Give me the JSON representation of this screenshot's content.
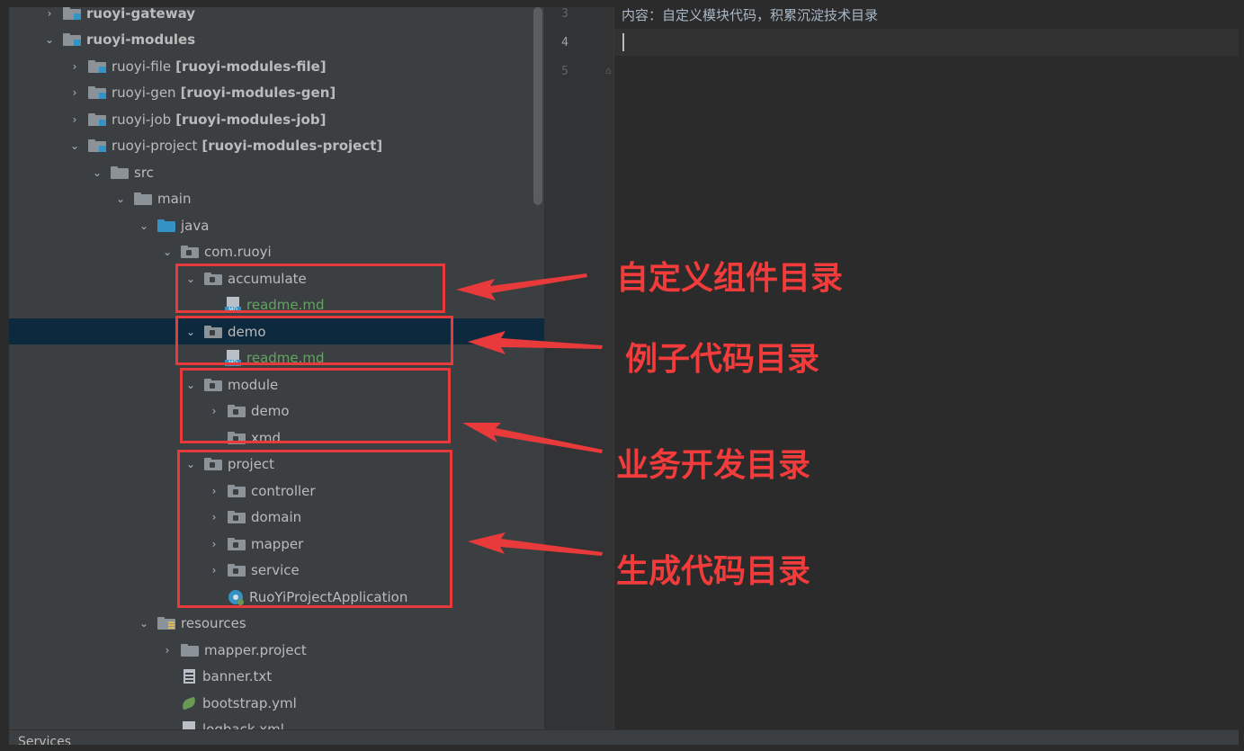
{
  "tree": {
    "items": [
      {
        "label": "ruoyi-gateway",
        "bold": true,
        "icon": "module-folder",
        "chevron": "collapsed"
      },
      {
        "label": "ruoyi-modules",
        "bold": true,
        "icon": "module-folder",
        "chevron": "expanded"
      },
      {
        "label": "ruoyi-file",
        "suffix": "[ruoyi-modules-file]",
        "icon": "module-folder",
        "chevron": "collapsed"
      },
      {
        "label": "ruoyi-gen",
        "suffix": "[ruoyi-modules-gen]",
        "icon": "module-folder",
        "chevron": "collapsed"
      },
      {
        "label": "ruoyi-job",
        "suffix": "[ruoyi-modules-job]",
        "icon": "module-folder",
        "chevron": "collapsed"
      },
      {
        "label": "ruoyi-project",
        "suffix": "[ruoyi-modules-project]",
        "icon": "module-folder",
        "chevron": "expanded"
      },
      {
        "label": "src",
        "icon": "folder",
        "chevron": "expanded"
      },
      {
        "label": "main",
        "icon": "folder",
        "chevron": "expanded"
      },
      {
        "label": "java",
        "icon": "source-folder",
        "chevron": "expanded"
      },
      {
        "label": "com.ruoyi",
        "icon": "package-folder",
        "chevron": "expanded"
      },
      {
        "label": "accumulate",
        "icon": "package-folder",
        "chevron": "expanded"
      },
      {
        "label": "readme.md",
        "icon": "markdown-file",
        "chevron": "none",
        "green": true
      },
      {
        "label": "demo",
        "icon": "package-folder",
        "chevron": "expanded",
        "selected": true
      },
      {
        "label": "readme.md",
        "icon": "markdown-file",
        "chevron": "none",
        "green": true
      },
      {
        "label": "module",
        "icon": "package-folder",
        "chevron": "expanded"
      },
      {
        "label": "demo",
        "icon": "package-folder",
        "chevron": "collapsed"
      },
      {
        "label": "xmd",
        "icon": "package-folder",
        "chevron": "none"
      },
      {
        "label": "project",
        "icon": "package-folder",
        "chevron": "expanded"
      },
      {
        "label": "controller",
        "icon": "package-folder",
        "chevron": "collapsed"
      },
      {
        "label": "domain",
        "icon": "package-folder",
        "chevron": "collapsed"
      },
      {
        "label": "mapper",
        "icon": "package-folder",
        "chevron": "collapsed"
      },
      {
        "label": "service",
        "icon": "package-folder",
        "chevron": "collapsed"
      },
      {
        "label": "RuoYiProjectApplication",
        "icon": "spring-app-class",
        "chevron": "none"
      },
      {
        "label": "resources",
        "icon": "resources-folder",
        "chevron": "expanded"
      },
      {
        "label": "mapper.project",
        "icon": "folder",
        "chevron": "collapsed"
      },
      {
        "label": "banner.txt",
        "icon": "text-file",
        "chevron": "none"
      },
      {
        "label": "bootstrap.yml",
        "icon": "yaml-file",
        "chevron": "none"
      },
      {
        "label": "logback.xml",
        "icon": "xml-file",
        "chevron": "none"
      }
    ]
  },
  "editor": {
    "lines": [
      {
        "number": "3",
        "text": "内容：自定义模块代码，积累沉淀技术目录"
      },
      {
        "number": "4",
        "text": ""
      },
      {
        "number": "5",
        "text": ""
      }
    ]
  },
  "statusbar": {
    "label": "Services"
  },
  "annotations": [
    {
      "text": "自定义组件目录"
    },
    {
      "text": "例子代码目录"
    },
    {
      "text": "业务开发目录"
    },
    {
      "text": "生成代码目录"
    }
  ],
  "colors": {
    "annotation_red": "#e83a3a",
    "selection": "#0d293e",
    "green_file": "#62a362",
    "tree_bg": "#3c3f41",
    "editor_bg": "#2b2b2b"
  }
}
